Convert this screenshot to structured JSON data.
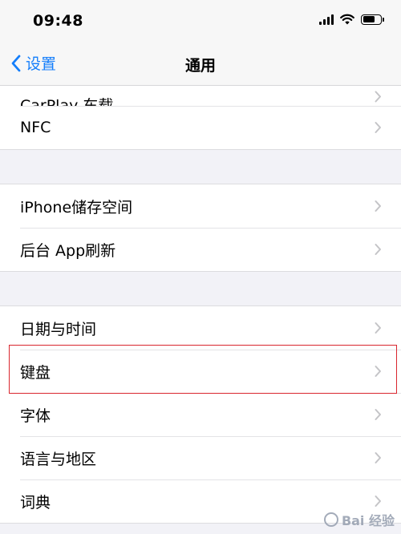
{
  "status_bar": {
    "time": "09:48"
  },
  "nav": {
    "back_label": "设置",
    "title": "通用"
  },
  "groups": [
    {
      "rows": [
        "CarPlay 车载",
        "NFC"
      ]
    },
    {
      "rows": [
        "iPhone储存空间",
        "后台 App刷新"
      ]
    },
    {
      "rows": [
        "日期与时间",
        "键盘",
        "字体",
        "语言与地区",
        "词典"
      ]
    }
  ],
  "highlighted_row": "键盘",
  "watermark": {
    "text": "Bai 经验"
  },
  "colors": {
    "accent": "#147efb",
    "highlight_border": "#d9262e",
    "background": "#f2f2f7"
  }
}
